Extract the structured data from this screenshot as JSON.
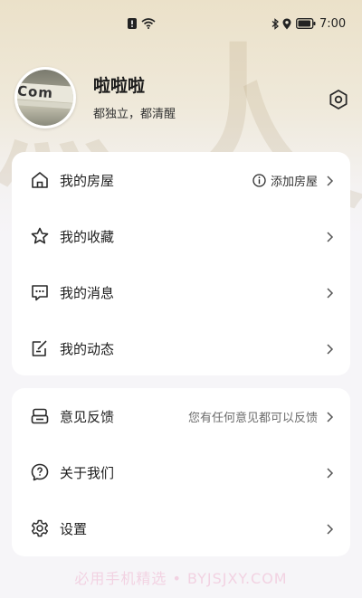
{
  "status_bar": {
    "time": "7:00"
  },
  "profile": {
    "name": "啦啦啦",
    "signature": "都独立，都清醒",
    "avatar_text": "Com"
  },
  "menu_group_1": [
    {
      "label": "我的房屋",
      "icon": "house-icon",
      "action_text": "添加房屋"
    },
    {
      "label": "我的收藏",
      "icon": "star-icon"
    },
    {
      "label": "我的消息",
      "icon": "message-icon"
    },
    {
      "label": "我的动态",
      "icon": "edit-note-icon"
    }
  ],
  "menu_group_2": [
    {
      "label": "意见反馈",
      "icon": "feedback-icon",
      "hint": "您有任何意见都可以反馈"
    },
    {
      "label": "关于我们",
      "icon": "question-icon"
    },
    {
      "label": "设置",
      "icon": "gear-icon"
    }
  ],
  "watermark": "必用手机精选 • BYJSJXY.COM",
  "colors": {
    "header_gradient_top": "#ebe1c9",
    "page_background": "#f6f5f8",
    "card_background": "#ffffff",
    "text_primary": "#1e1e1e",
    "text_secondary": "#6b6b6b"
  }
}
